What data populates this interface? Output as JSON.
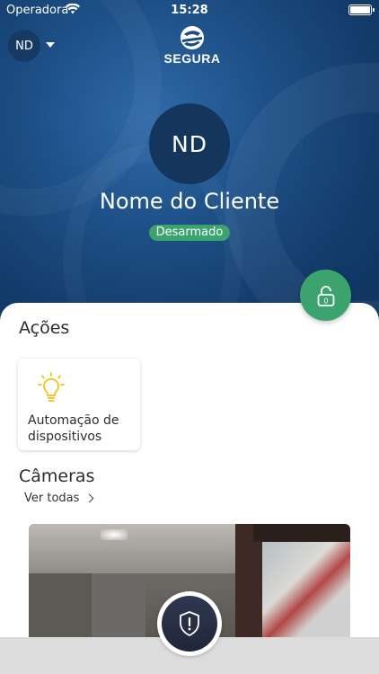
{
  "status_bar": {
    "carrier": "Operadora",
    "time": "15:28"
  },
  "header": {
    "account_initials": "ND",
    "brand": "SEGURA"
  },
  "profile": {
    "initials": "ND",
    "client_name": "Nome do Cliente",
    "status": "Desarmado"
  },
  "lock": {
    "code": "0"
  },
  "actions": {
    "title": "Ações",
    "items": [
      {
        "label": "Automação de dispositivos",
        "icon": "lightbulb-icon"
      }
    ]
  },
  "cameras": {
    "title": "Câmeras",
    "see_all_label": "Ver todas"
  },
  "colors": {
    "accent_green": "#3aa36e",
    "hero_blue": "#1d4f86",
    "alert_dark": "#262d43",
    "bulb_yellow": "#f2c318"
  }
}
